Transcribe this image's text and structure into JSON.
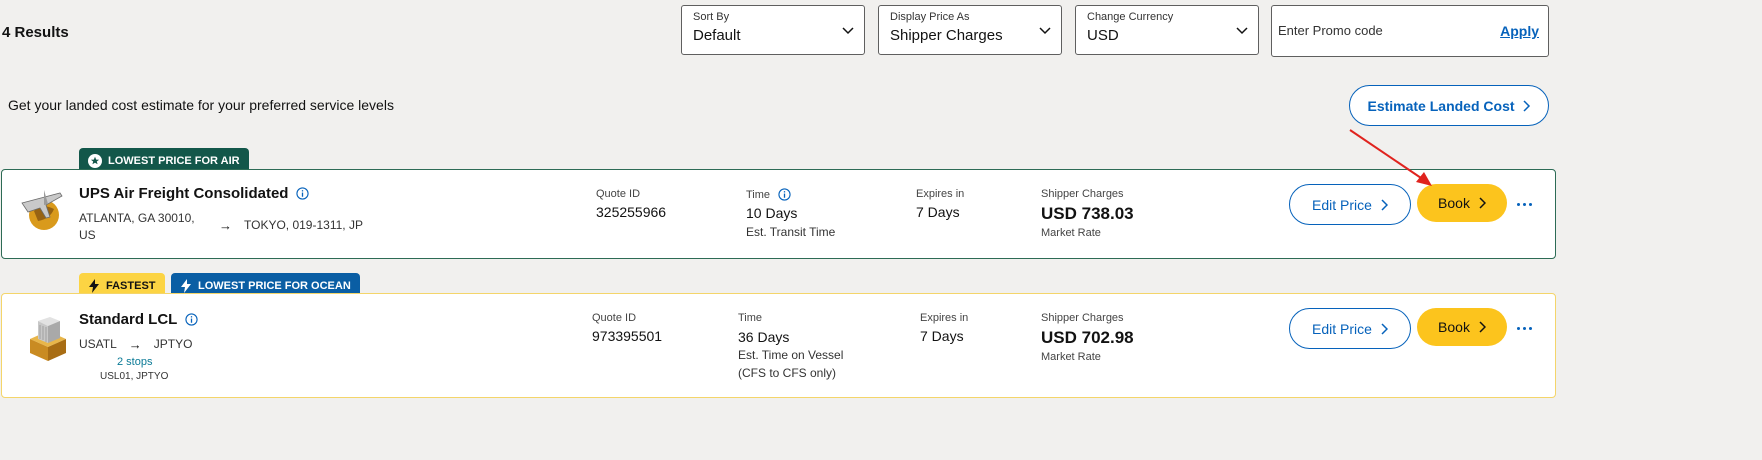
{
  "header": {
    "results_count": "4 Results",
    "sort_by": {
      "label": "Sort By",
      "value": "Default"
    },
    "display_price": {
      "label": "Display Price As",
      "value": "Shipper Charges"
    },
    "currency": {
      "label": "Change Currency",
      "value": "USD"
    },
    "promo": {
      "placeholder": "Enter Promo code",
      "apply_label": "Apply"
    }
  },
  "landed": {
    "text": "Get your landed cost estimate for your preferred service levels",
    "button_label": "Estimate Landed Cost"
  },
  "quotes": [
    {
      "badges": [
        "LOWEST PRICE FOR AIR"
      ],
      "service_name": "UPS Air Freight Consolidated",
      "origin": "ATLANTA, GA 30010,\nUS",
      "destination": "TOKYO, 019-1311, JP",
      "quote_id_label": "Quote ID",
      "quote_id": "325255966",
      "time_label": "Time",
      "time_value": "10 Days",
      "time_note": "Est. Transit Time",
      "expires_label": "Expires in",
      "expires_value": "7 Days",
      "price_label": "Shipper Charges",
      "price": "USD 738.03",
      "price_note": "Market Rate",
      "edit_label": "Edit Price",
      "book_label": "Book"
    },
    {
      "badges": [
        "FASTEST",
        "LOWEST PRICE FOR OCEAN"
      ],
      "service_name": "Standard LCL",
      "origin": "USATL",
      "destination": "JPTYO",
      "stops": "2 stops",
      "stops_via": "USL01, JPTYO",
      "quote_id_label": "Quote ID",
      "quote_id": "973395501",
      "time_label": "Time",
      "time_value": "36 Days",
      "time_note": "Est. Time on Vessel\n(CFS to CFS only)",
      "expires_label": "Expires in",
      "expires_value": "7 Days",
      "price_label": "Shipper Charges",
      "price": "USD 702.98",
      "price_note": "Market Rate",
      "edit_label": "Edit Price",
      "book_label": "Book"
    }
  ],
  "colors": {
    "brand_blue": "#0662bb",
    "book_yellow": "#fcc41d",
    "air_badge": "#13574a",
    "ocean_badge": "#0a5ea4",
    "annotation_arrow": "#e0231e"
  }
}
